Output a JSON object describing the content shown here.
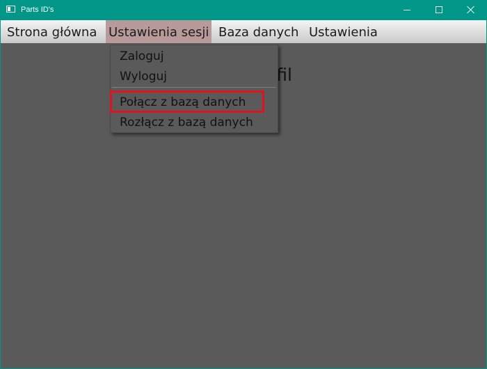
{
  "window": {
    "title": "Parts ID's",
    "accent_color": "#009688",
    "controls": [
      "minimize-icon",
      "maximize-icon",
      "close-icon"
    ]
  },
  "menubar": {
    "items": [
      {
        "label": "Strona główna"
      },
      {
        "label": "Ustawienia sesji",
        "active": true
      },
      {
        "label": "Baza danych"
      },
      {
        "label": "Ustawienia"
      }
    ]
  },
  "dropdown": {
    "items": [
      {
        "label": "Zaloguj"
      },
      {
        "label": "Wyloguj"
      },
      {
        "label": "Połącz z bazą danych",
        "highlighted": true
      },
      {
        "label": "Rozłącz z bazą danych"
      }
    ],
    "highlight_color": "#e0141c"
  },
  "content": {
    "heading_visible_fragment": "ofil"
  }
}
